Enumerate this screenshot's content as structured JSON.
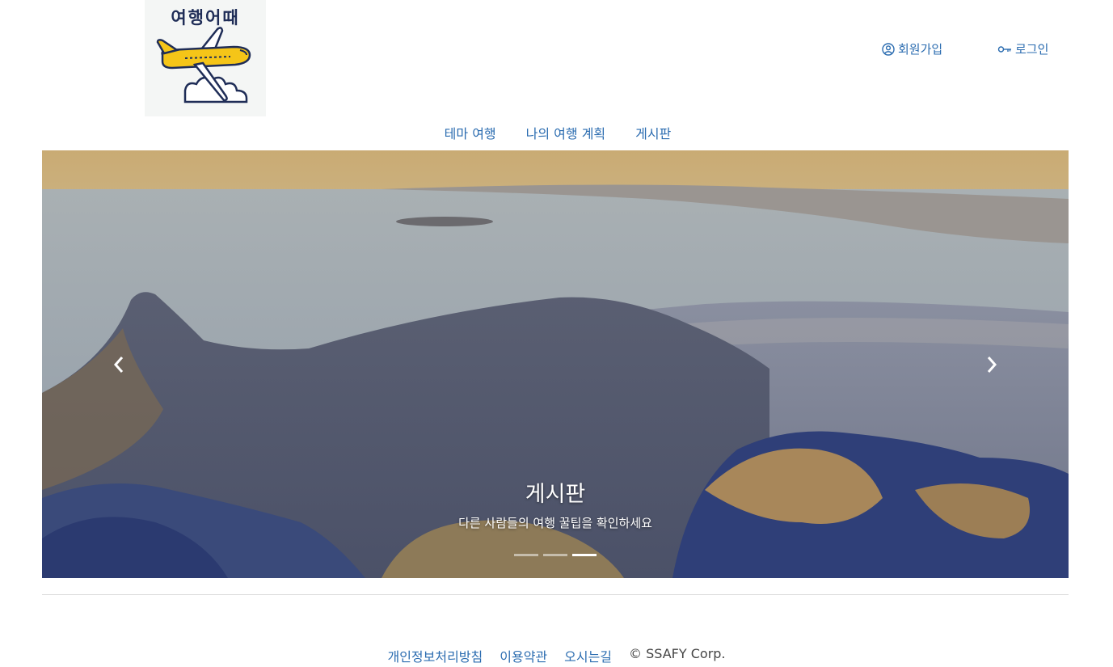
{
  "logo": {
    "text": "여행어때"
  },
  "auth": {
    "signup_label": "회원가입",
    "login_label": "로그인",
    "signup_icon": "user-circle-icon",
    "login_icon": "key-icon"
  },
  "nav": {
    "items": [
      {
        "label": "테마 여행"
      },
      {
        "label": "나의 여행 계획"
      },
      {
        "label": "게시판"
      }
    ]
  },
  "carousel": {
    "caption_title": "게시판",
    "caption_subtitle": "다른 사람들의 여행 꿀팁을 확인하세요",
    "slide_count": 3,
    "active_index": 2
  },
  "footer": {
    "links": [
      {
        "label": "개인정보처리방침"
      },
      {
        "label": "이용약관"
      },
      {
        "label": "오시는길"
      }
    ],
    "copyright": "© SSAFY Corp."
  },
  "colors": {
    "link": "#2b6cb0",
    "logo_navy": "#1f2d57",
    "plane_yellow": "#f5c518"
  }
}
